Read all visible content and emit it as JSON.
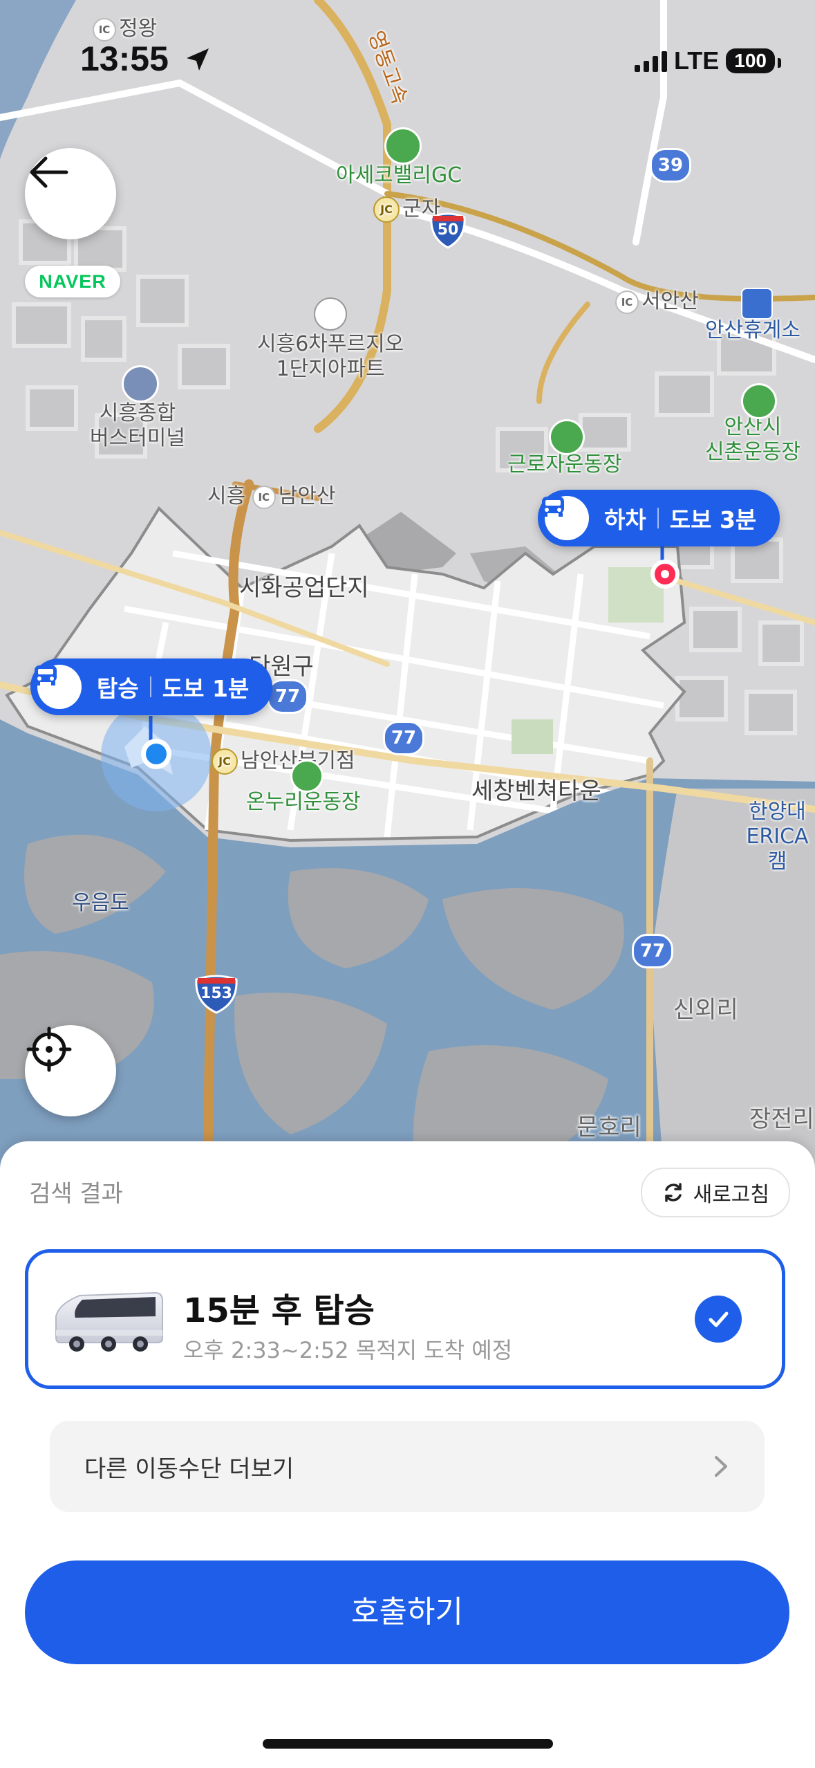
{
  "status_bar": {
    "time": "13:55",
    "network": "LTE",
    "battery": "100",
    "icons": [
      "location-arrow-icon",
      "signal-icon"
    ]
  },
  "map": {
    "logo": "NAVER",
    "labels": {
      "jeongwang": "정왕",
      "highway": "영동고속",
      "golf": "아세코밸리GC",
      "gunja": "군자",
      "apt": "시흥6차푸르지오\n1단지아파트",
      "terminal": "시흥종합\n버스터미널",
      "seoansan": "서안산",
      "rest_area": "안산휴게소",
      "shinchon": "안산시\n신촌운동장",
      "worker_field": "근로자운동장",
      "namansan": "남안산",
      "siheung_station": "시흥",
      "industrial": "시화공업단지",
      "danwon": "단원구",
      "namansan_jct": "남안산분기점",
      "onnuri": "온누리운동장",
      "sechang": "세창벤쳐타운",
      "hanyang": "한양대\nERICA캠",
      "ueumdo": "우음도",
      "sinoeri": "신외리",
      "munhori": "문호리",
      "jangjeon": "장전리",
      "ic": "IC",
      "jc": "JC"
    },
    "routes": {
      "r39": "39",
      "r50": "50",
      "r77": "77",
      "r153": "153"
    },
    "dropoff_bubble": {
      "label": "하차",
      "walk": "도보 3분"
    },
    "pickup_bubble": {
      "label": "탑승",
      "walk": "도보 1분"
    },
    "colors": {
      "bubble": "#1e5ee8",
      "service_area": "#ececec",
      "water": "#7f9fbf"
    }
  },
  "sheet": {
    "title": "검색 결과",
    "refresh_label": "새로고침",
    "option": {
      "title": "15분 후 탑승",
      "subtitle": "오후 2:33~2:52 목적지 도착 예정",
      "selected": true
    },
    "more_label": "다른 이동수단 더보기",
    "call_label": "호출하기",
    "accent": "#1e5ee8"
  }
}
